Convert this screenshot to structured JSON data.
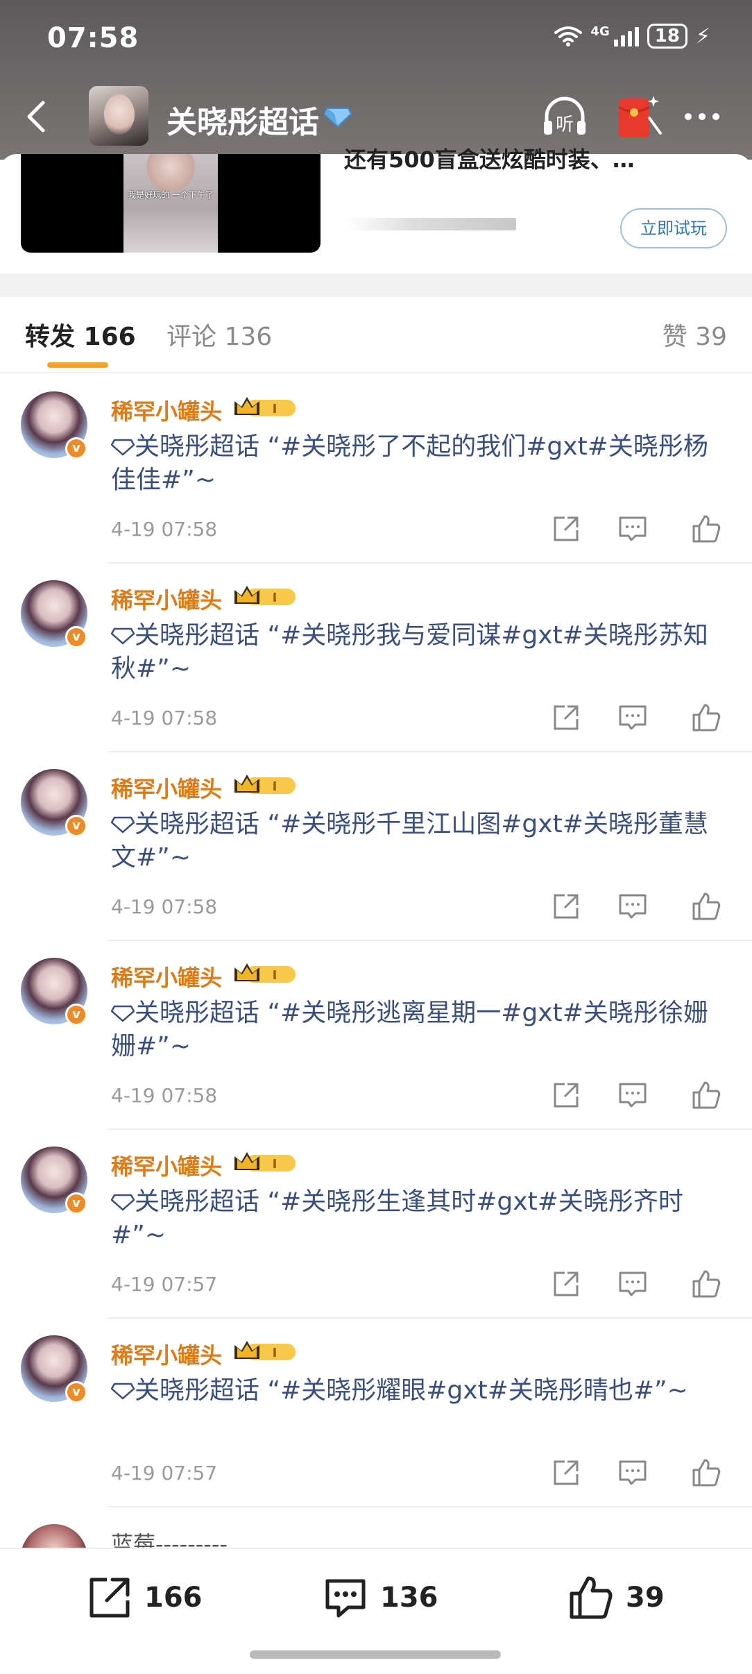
{
  "status_bar": {
    "time": "07:58",
    "network": "4G",
    "battery": "18",
    "icons": [
      "wifi-icon",
      "signal-icon",
      "battery-icon",
      "charging-icon"
    ]
  },
  "header": {
    "title": "关晓彤超话",
    "icons": [
      "back-icon",
      "diamond-badge-icon",
      "listen-icon",
      "red-packet-icon",
      "more-icon"
    ],
    "listen_label": "听"
  },
  "promo": {
    "video_caption": "我是好玩的 一个下午了",
    "text": "还有500盲盒送炫酷时装、…",
    "button_label": "立即试玩"
  },
  "tabs": {
    "repost": "转发 166",
    "comments": "评论 136",
    "likes": "赞 39"
  },
  "posts": [
    {
      "user": "稀罕小罐头",
      "text": "关晓彤超话 “#关晓彤了不起的我们#gxt#关晓彤杨佳佳#”~",
      "time": "4-19 07:58"
    },
    {
      "user": "稀罕小罐头",
      "text": "关晓彤超话 “#关晓彤我与爱同谋#gxt#关晓彤苏知秋#”~",
      "time": "4-19 07:58"
    },
    {
      "user": "稀罕小罐头",
      "text": "关晓彤超话 “#关晓彤千里江山图#gxt#关晓彤董慧文#”~",
      "time": "4-19 07:58"
    },
    {
      "user": "稀罕小罐头",
      "text": "关晓彤超话 “#关晓彤逃离星期一#gxt#关晓彤徐姗姗#”~",
      "time": "4-19 07:58"
    },
    {
      "user": "稀罕小罐头",
      "text": "关晓彤超话 “#关晓彤生逢其时#gxt#关晓彤齐时#”~",
      "time": "4-19 07:57"
    },
    {
      "user": "稀罕小罐头",
      "text": "关晓彤超话 “#关晓彤耀眼#gxt#关晓彤晴也#”~",
      "time": "4-19 07:57"
    }
  ],
  "partial_post": {
    "user": "蓝莓---------"
  },
  "bottom_bar": {
    "share_count": "166",
    "comment_count": "136",
    "like_count": "39"
  },
  "colors": {
    "accent": "#f5a623",
    "username": "#e07a14",
    "topic_link": "#3b4f7f",
    "button_blue": "#2f78b7"
  }
}
